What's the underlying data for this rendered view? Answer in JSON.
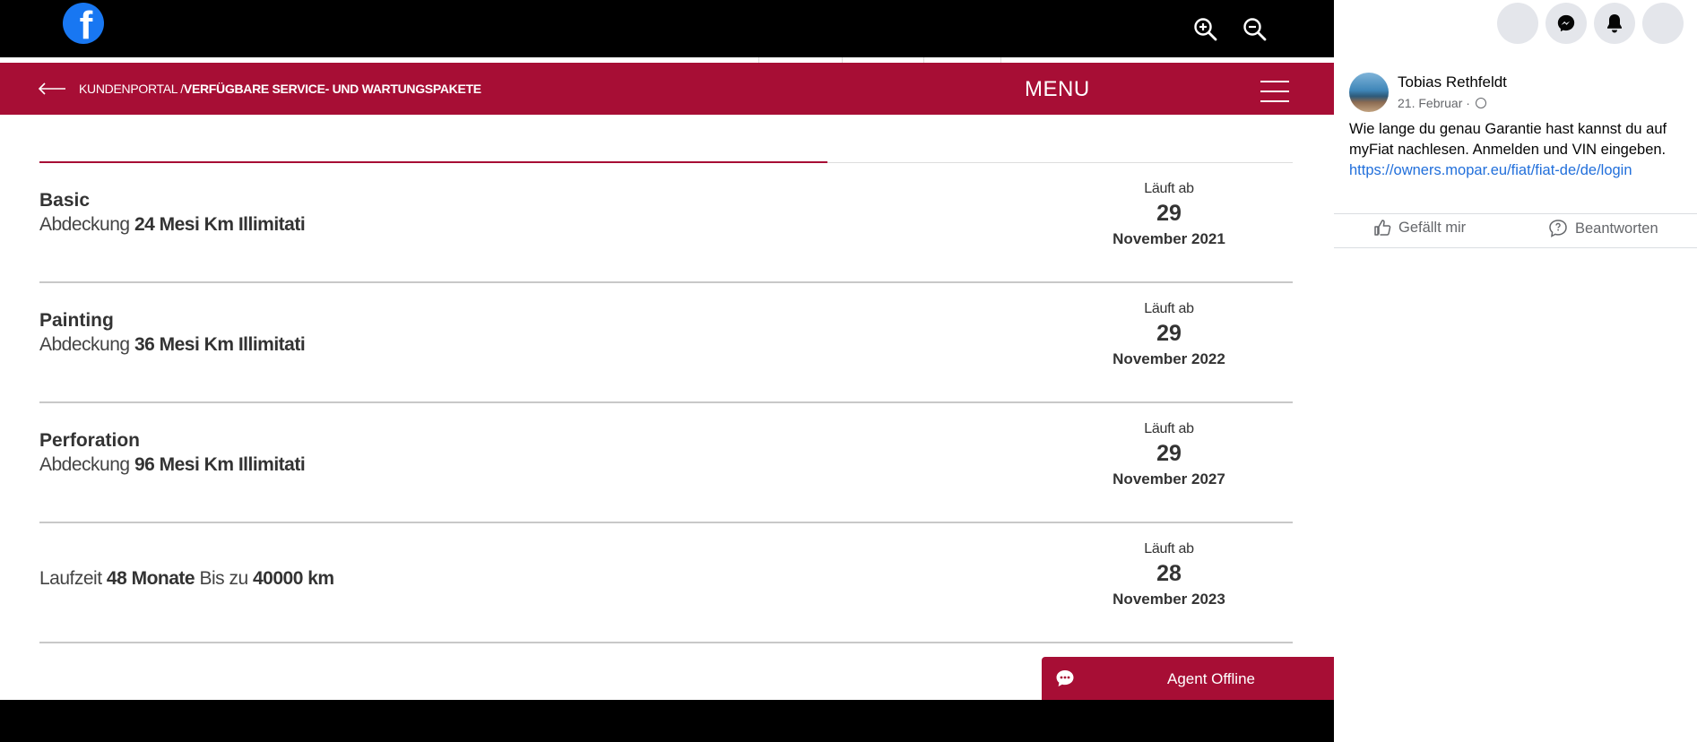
{
  "viewer": {
    "logo": "facebook-logo",
    "zoom_in_icon": "zoom-in-icon",
    "zoom_out_icon": "zoom-out-icon"
  },
  "screenshot": {
    "brand_color": "#a70e35",
    "breadcrumb_prefix": "KUNDENPORTAL /",
    "breadcrumb_current": "VERFÜGBARE SERVICE- UND WARTUNGSPAKETE",
    "menu_label": "MENU",
    "packages": [
      {
        "name": "Basic",
        "coverage_prefix": "Abdeckung",
        "coverage_value": "24 Mesi Km Illimitati",
        "expiry_label": "Läuft ab",
        "expiry_day": "29",
        "expiry_month": "November 2021"
      },
      {
        "name": "Painting",
        "coverage_prefix": "Abdeckung",
        "coverage_value": "36 Mesi Km Illimitati",
        "expiry_label": "Läuft ab",
        "expiry_day": "29",
        "expiry_month": "November 2022"
      },
      {
        "name": "Perforation",
        "coverage_prefix": "Abdeckung",
        "coverage_value": "96 Mesi Km Illimitati",
        "expiry_label": "Läuft ab",
        "expiry_day": "29",
        "expiry_month": "November 2027"
      },
      {
        "runtime_label": "Laufzeit",
        "runtime_value": "48 Monate",
        "limit_label": "Bis zu",
        "limit_value": "40000 km",
        "expiry_label": "Läuft ab",
        "expiry_day": "28",
        "expiry_month": "November 2023"
      }
    ],
    "agent_label": "Agent Offline"
  },
  "panel": {
    "top_buttons": [
      "menu-button",
      "messenger-icon",
      "bell-icon",
      "account-button"
    ],
    "comment": {
      "author": "Tobias Rethfeldt",
      "date": "21. Februar ·",
      "text": "Wie lange du genau Garantie hast kannst du auf myFiat nachlesen. Anmelden und VIN eingeben.",
      "link": "https://owners.mopar.eu/fiat/fiat-de/de/login"
    },
    "actions": {
      "like": "Gefällt mir",
      "reply": "Beantworten"
    }
  }
}
